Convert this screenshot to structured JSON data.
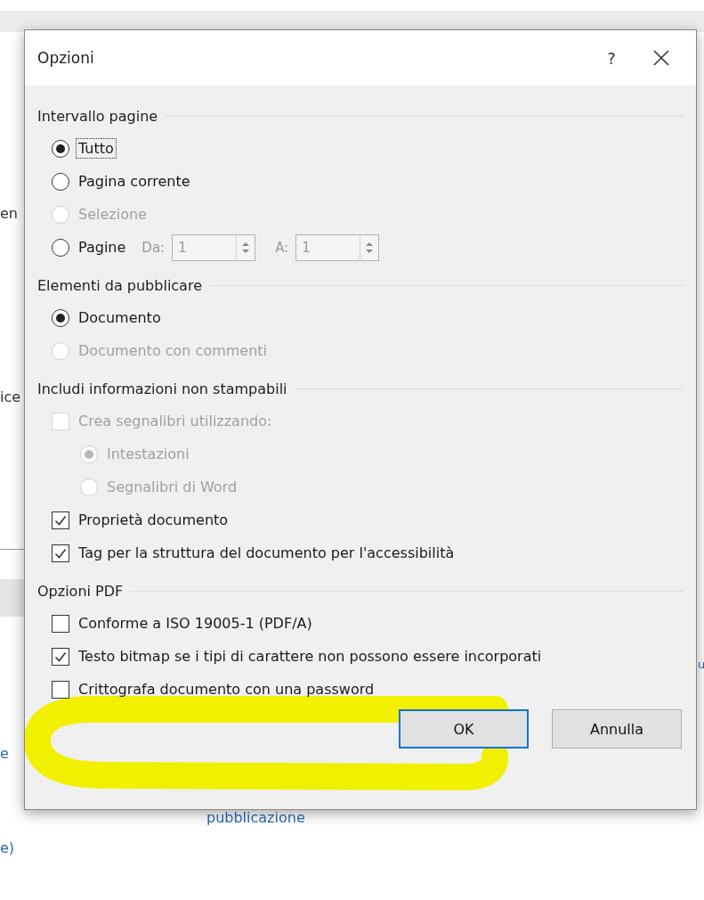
{
  "background": {
    "fragments": [
      {
        "text": "en",
        "kind": "plain"
      },
      {
        "text": "ice",
        "kind": "plain"
      },
      {
        "text": "e",
        "kind": "link"
      },
      {
        "text": "e)",
        "kind": "link"
      },
      {
        "text": "u",
        "kind": "link"
      },
      {
        "text": "pubblicazione",
        "kind": "link"
      }
    ]
  },
  "dialog": {
    "title": "Opzioni",
    "help_button": "?",
    "sections": [
      {
        "heading": "Intervallo pagine",
        "items": [
          {
            "kind": "radio",
            "label": "Tutto",
            "selected": true,
            "disabled": false,
            "focused": true
          },
          {
            "kind": "radio",
            "label": "Pagina corrente",
            "selected": false,
            "disabled": false,
            "focused": false
          },
          {
            "kind": "radio",
            "label": "Selezione",
            "selected": false,
            "disabled": true,
            "focused": false
          },
          {
            "kind": "radio",
            "label": "Pagine",
            "selected": false,
            "disabled": false,
            "focused": false,
            "range": {
              "from_label": "Da:",
              "from_value": "1",
              "to_label": "A:",
              "to_value": "1",
              "disabled": true
            }
          }
        ]
      },
      {
        "heading": "Elementi da pubblicare",
        "items": [
          {
            "kind": "radio",
            "label": "Documento",
            "selected": true,
            "disabled": false,
            "focused": false
          },
          {
            "kind": "radio",
            "label": "Documento con commenti",
            "selected": false,
            "disabled": true,
            "focused": false
          }
        ]
      },
      {
        "heading": "Includi informazioni non stampabili",
        "items": [
          {
            "kind": "checkbox",
            "label": "Crea segnalibri utilizzando:",
            "checked": false,
            "disabled": true,
            "focused": false,
            "children": [
              {
                "kind": "radio",
                "label": "Intestazioni",
                "selected": true,
                "disabled": true,
                "focused": false
              },
              {
                "kind": "radio",
                "label": "Segnalibri di Word",
                "selected": false,
                "disabled": true,
                "focused": false
              }
            ]
          },
          {
            "kind": "checkbox",
            "label": "Proprietà documento",
            "checked": true,
            "disabled": false,
            "focused": false
          },
          {
            "kind": "checkbox",
            "label": "Tag per la struttura del documento per l'accessibilità",
            "checked": true,
            "disabled": false,
            "focused": false
          }
        ]
      },
      {
        "heading": "Opzioni PDF",
        "items": [
          {
            "kind": "checkbox",
            "label": "Conforme a ISO 19005-1 (PDF/A)",
            "checked": false,
            "disabled": false,
            "focused": false
          },
          {
            "kind": "checkbox",
            "label": "Testo bitmap se i tipi di carattere non possono essere incorporati",
            "checked": true,
            "disabled": false,
            "focused": false
          },
          {
            "kind": "checkbox",
            "label": "Crittografa documento con una password",
            "checked": false,
            "disabled": false,
            "focused": false
          }
        ]
      }
    ],
    "buttons": [
      {
        "label": "OK",
        "default": true
      },
      {
        "label": "Annulla",
        "default": false
      }
    ]
  },
  "annotation": {
    "kind": "highlighter"
  }
}
